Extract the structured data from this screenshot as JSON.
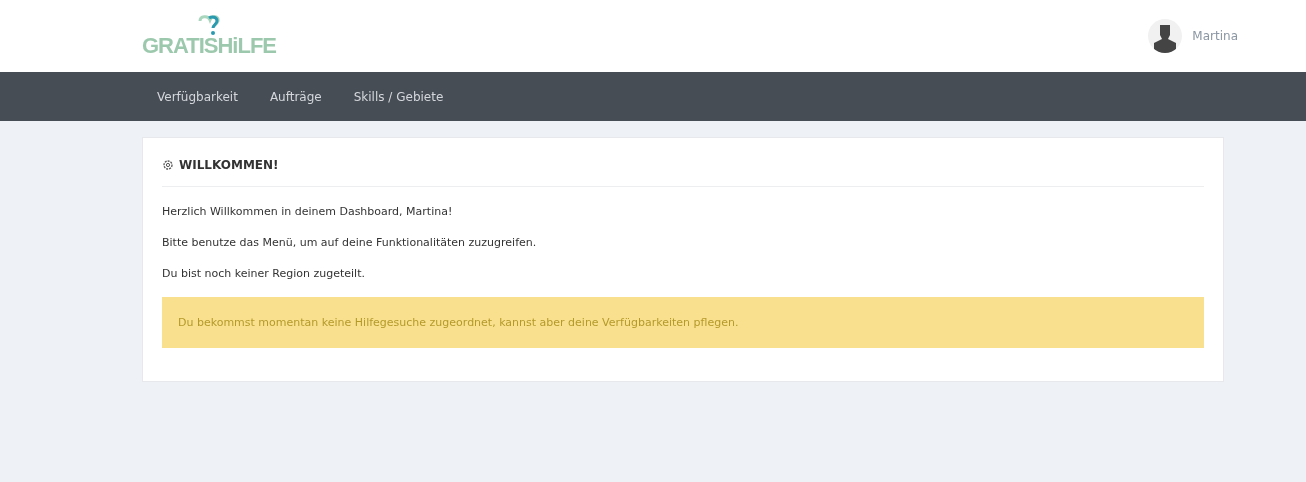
{
  "logo": {
    "text": "GRATISHiLFE"
  },
  "user": {
    "name": "Martina"
  },
  "nav": [
    {
      "label": "Verfügbarkeit"
    },
    {
      "label": "Aufträge"
    },
    {
      "label": "Skills / Gebiete"
    }
  ],
  "card": {
    "title": "WILLKOMMEN!",
    "paragraphs": [
      "Herzlich Willkommen in deinem Dashboard, Martina!",
      "Bitte benutze das Menü, um auf deine Funktionalitäten zuzugreifen.",
      "Du bist noch keiner Region zugeteilt."
    ],
    "alert": {
      "text": "Du bekommst momentan keine Hilfegesuche zugeordnet, kannst aber deine Verfügbarkeiten pflegen."
    }
  }
}
